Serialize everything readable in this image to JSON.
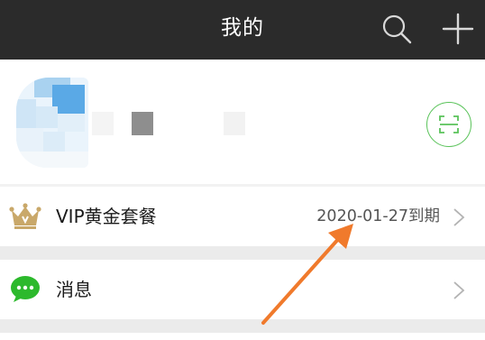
{
  "header": {
    "title": "我的",
    "search_icon": "search-icon",
    "add_icon": "plus-icon",
    "background": "#2b2b2b"
  },
  "profile": {
    "avatar": "blurred-avatar",
    "qr_icon": "scan-icon",
    "accent": "#5ac35a"
  },
  "list": {
    "vip": {
      "icon": "crown-icon",
      "label": "VIP黄金套餐",
      "value": "2020-01-27到期",
      "chevron": "chevron-right-icon"
    },
    "messages": {
      "icon": "chat-bubble-icon",
      "label": "消息",
      "chevron": "chevron-right-icon"
    }
  },
  "annotation": {
    "type": "arrow",
    "color": "#f07a2c"
  }
}
